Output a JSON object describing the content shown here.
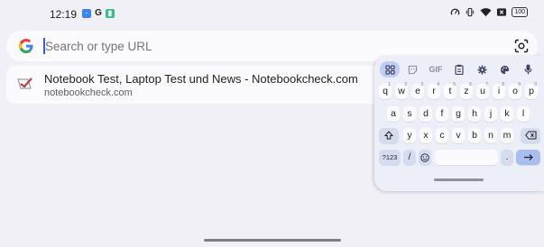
{
  "status_bar": {
    "time": "12:19",
    "notification_icons": [
      "notification-icon",
      "google-g-icon",
      "wellbeing-icon"
    ],
    "battery": "100",
    "system_icons": [
      "speedometer-icon",
      "vibrate-icon",
      "wifi-icon",
      "battery-saver-icon",
      "battery-icon"
    ]
  },
  "search": {
    "placeholder": "Search or type URL",
    "value": ""
  },
  "suggestion": {
    "title": "Notebook Test, Laptop Test und News - Notebookcheck.com",
    "url": "notebookcheck.com"
  },
  "keyboard": {
    "toolbar": [
      "apps-grid-icon",
      "sticker-icon",
      "GIF",
      "clipboard-icon",
      "gear-icon",
      "palette-icon",
      "mic-icon"
    ],
    "gif_label": "GIF",
    "row1": [
      {
        "k": "q",
        "h": "1"
      },
      {
        "k": "w",
        "h": "2"
      },
      {
        "k": "e",
        "h": "3"
      },
      {
        "k": "r",
        "h": "4"
      },
      {
        "k": "t",
        "h": "5"
      },
      {
        "k": "z",
        "h": "6"
      },
      {
        "k": "u",
        "h": "7"
      },
      {
        "k": "i",
        "h": "8"
      },
      {
        "k": "o",
        "h": "9"
      },
      {
        "k": "p",
        "h": "0"
      }
    ],
    "row2": [
      "a",
      "s",
      "d",
      "f",
      "g",
      "h",
      "j",
      "k",
      "l"
    ],
    "row3": [
      "y",
      "x",
      "c",
      "v",
      "b",
      "n",
      "m"
    ],
    "sym_label": "?123",
    "slash": "/",
    "period": "."
  },
  "colors": {
    "accent": "#c2cdf3",
    "enter": "#a9bdf1",
    "background": "#f1f0f6"
  }
}
